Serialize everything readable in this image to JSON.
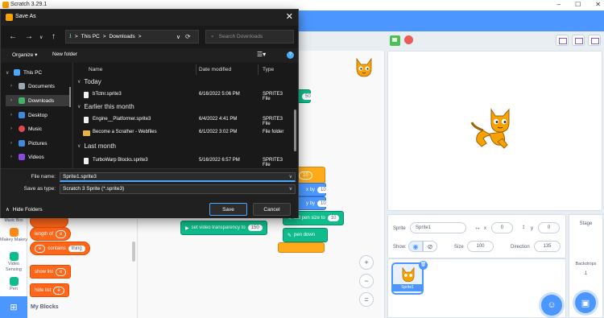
{
  "window": {
    "title": "Scratch 3.29.1",
    "controls": [
      "–",
      "☐",
      "✕"
    ]
  },
  "dialog": {
    "title": "Save As",
    "close": "✕",
    "address": [
      "This PC",
      "Downloads"
    ],
    "separator": ">",
    "search_placeholder": "Search Downloads",
    "commands": {
      "organize": "Organize ▾",
      "new_folder": "New folder"
    },
    "nav_tree": [
      {
        "label": "This PC",
        "expanded": true,
        "color": "#4aa8ff"
      },
      {
        "label": "Documents",
        "color": "#9aa6b2"
      },
      {
        "label": "Downloads",
        "color": "#3fb567",
        "selected": true
      },
      {
        "label": "Desktop",
        "color": "#3f8ae0"
      },
      {
        "label": "Music",
        "color": "#e0484c"
      },
      {
        "label": "Pictures",
        "color": "#3f8ae0"
      },
      {
        "label": "Videos",
        "color": "#8a4ae0"
      }
    ],
    "columns": {
      "name": "Name",
      "date": "Date modified",
      "type": "Type"
    },
    "groups": [
      {
        "label": "Today",
        "files": [
          {
            "name": "bTctnr.sprite3",
            "date": "6/16/2022 5:06 PM",
            "type": "SPRITE3 File",
            "kind": "file"
          }
        ]
      },
      {
        "label": "Earlier this month",
        "files": [
          {
            "name": "Engine__Platformer.sprite3",
            "date": "6/4/2022 4:41 PM",
            "type": "SPRITE3 File",
            "kind": "file"
          },
          {
            "name": "Become a Scrather - Webfiles",
            "date": "6/1/2022 3:02 PM",
            "type": "File folder",
            "kind": "folder"
          }
        ]
      },
      {
        "label": "Last month",
        "files": [
          {
            "name": "TurboWarp Blocks.sprite3",
            "date": "5/16/2022 6:57 PM",
            "type": "SPRITE3 File",
            "kind": "file"
          }
        ]
      }
    ],
    "file_name_label": "File name:",
    "file_name_value": "Sprite1.sprite3",
    "save_type_label": "Save as type:",
    "save_type_value": "Scratch 3 Sprite (*.sprite3)",
    "hide_folders": "Hide Folders",
    "save": "Save",
    "cancel": "Cancel"
  },
  "categories": [
    {
      "label": "Makey Makey",
      "color": "#ff8c1a"
    },
    {
      "label": "Video Sensing",
      "color": "#0fbd8c"
    },
    {
      "label": "Pen",
      "color": "#0fbd8c"
    }
  ],
  "palette": {
    "length_of": "length of",
    "e": "e",
    "contains": "contains",
    "thing": "thing",
    "show_list": "show list",
    "hide_list": "hide list",
    "my_blocks": "My Blocks"
  },
  "code": {
    "value_50": "50",
    "value_10": "10",
    "x_by": "x by",
    "y_by": "y by",
    "set_pen_size_to": "set pen size to",
    "pen_down": "pen down",
    "set_video_transparency_to": "set video transparency to",
    "value_150": "150",
    "zoom_in": "+",
    "zoom_out": "−",
    "zoom_reset": "="
  },
  "sprite_info": {
    "sprite_label": "Sprite",
    "sprite_name": "Sprite1",
    "x_label": "x",
    "x_value": "0",
    "y_label": "y",
    "y_value": "0",
    "show_label": "Show:",
    "size_label": "Size",
    "size_value": "100",
    "direction_label": "Direction",
    "direction_value": "135"
  },
  "sprite_tile": {
    "name": "Sprite1"
  },
  "stage_pane": {
    "title": "Stage",
    "backdrops_label": "Backdrops",
    "backdrops_count": "1"
  }
}
